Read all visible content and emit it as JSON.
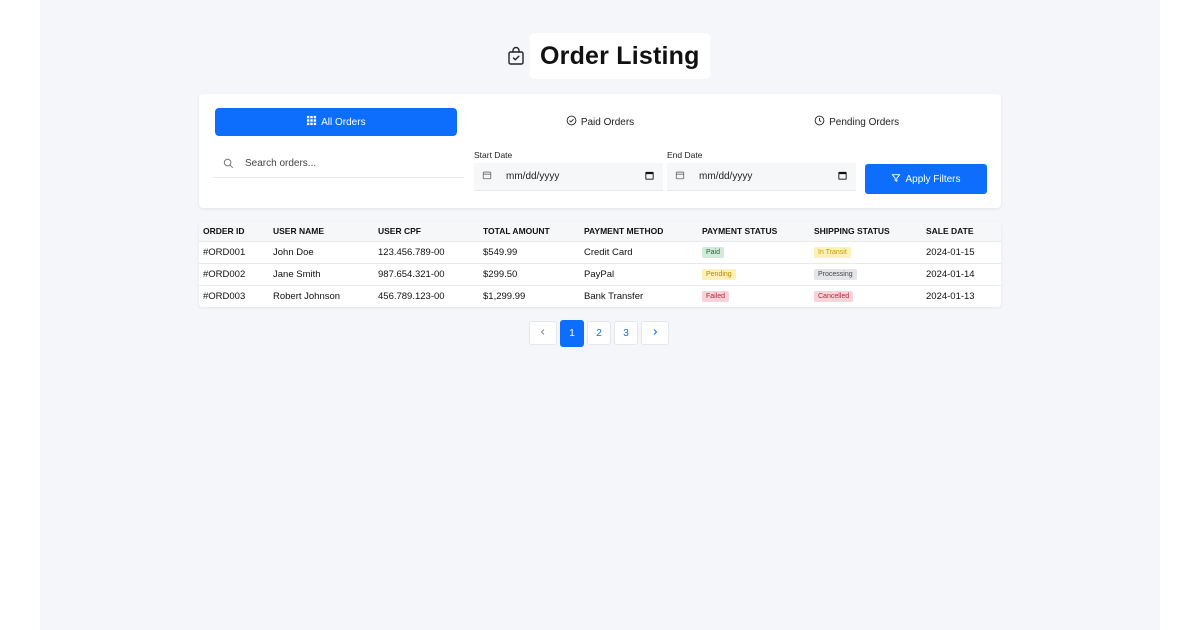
{
  "header": {
    "title": "Order Listing",
    "icon": "shopping-bag-check-icon"
  },
  "tabs": [
    {
      "label": "All Orders",
      "icon": "grid-icon",
      "active": true
    },
    {
      "label": "Paid Orders",
      "icon": "check-circle-icon",
      "active": false
    },
    {
      "label": "Pending Orders",
      "icon": "clock-icon",
      "active": false
    }
  ],
  "filters": {
    "search_placeholder": "Search orders...",
    "start_date_label": "Start Date",
    "start_date_value": "mm/dd/yyyy",
    "end_date_label": "End Date",
    "end_date_value": "mm/dd/yyyy",
    "apply_label": "Apply Filters"
  },
  "table": {
    "columns": [
      "ORDER ID",
      "USER NAME",
      "USER CPF",
      "TOTAL AMOUNT",
      "PAYMENT METHOD",
      "PAYMENT STATUS",
      "SHIPPING STATUS",
      "SALE DATE"
    ],
    "rows": [
      {
        "order_id": "#ORD001",
        "user_name": "John Doe",
        "cpf": "123.456.789-00",
        "total": "$549.99",
        "method": "Credit Card",
        "payment_status": "Paid",
        "shipping_status": "In Transit",
        "date": "2024-01-15"
      },
      {
        "order_id": "#ORD002",
        "user_name": "Jane Smith",
        "cpf": "987.654.321-00",
        "total": "$299.50",
        "method": "PayPal",
        "payment_status": "Pending",
        "shipping_status": "Processing",
        "date": "2024-01-14"
      },
      {
        "order_id": "#ORD003",
        "user_name": "Robert Johnson",
        "cpf": "456.789.123-00",
        "total": "$1,299.99",
        "method": "Bank Transfer",
        "payment_status": "Failed",
        "shipping_status": "Cancelled",
        "date": "2024-01-13"
      }
    ]
  },
  "badge_colors": {
    "Paid": {
      "bg": "#d1ead9",
      "fg": "#1e6b3a"
    },
    "Pending": {
      "bg": "#fdf0b8",
      "fg": "#b58a00"
    },
    "Failed": {
      "bg": "#f8d4d8",
      "fg": "#b3263b"
    },
    "In Transit": {
      "bg": "#fdf0b8",
      "fg": "#c79b00"
    },
    "Processing": {
      "bg": "#e3e5e8",
      "fg": "#444"
    },
    "Cancelled": {
      "bg": "#f8d4d8",
      "fg": "#b3263b"
    }
  },
  "pagination": {
    "pages": [
      "1",
      "2",
      "3"
    ],
    "current": "1"
  },
  "colors": {
    "accent": "#0d6efd",
    "background": "#f4f6fa"
  }
}
